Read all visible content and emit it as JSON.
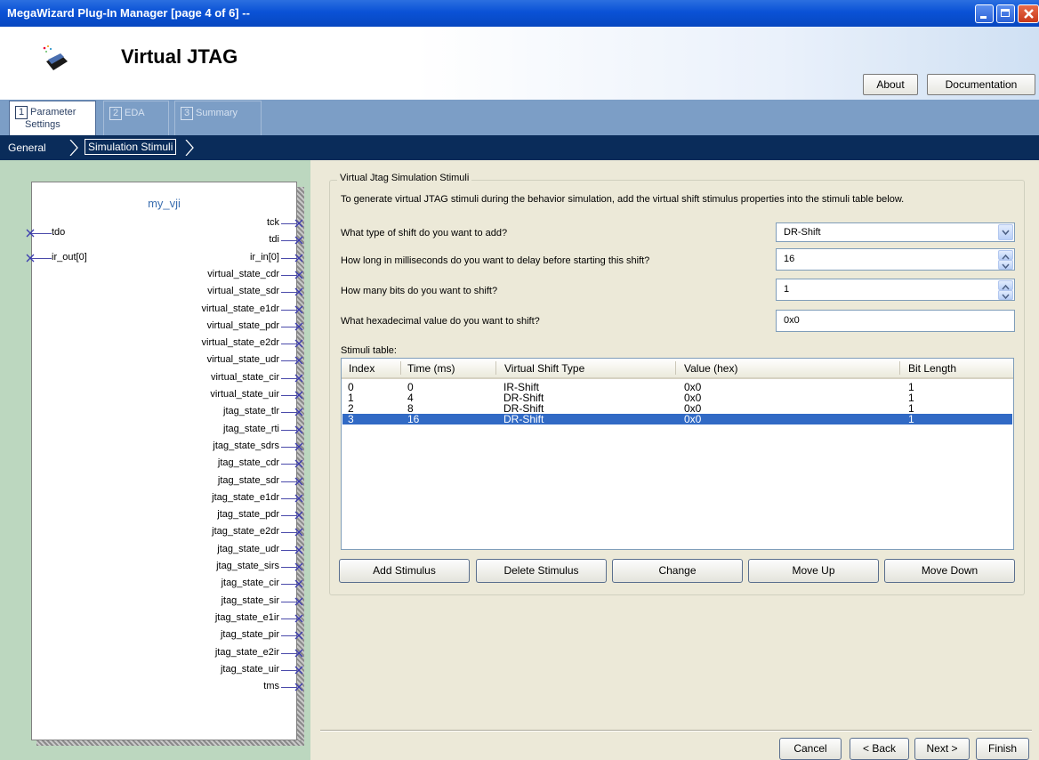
{
  "window": {
    "title": "MegaWizard Plug-In Manager [page 4 of 6] --"
  },
  "header": {
    "title": "Virtual JTAG",
    "about_label": "About",
    "documentation_label": "Documentation"
  },
  "tabs": [
    {
      "num": "1",
      "label_line1": "Parameter",
      "label_line2": "Settings"
    },
    {
      "num": "2",
      "label": "EDA"
    },
    {
      "num": "3",
      "label": "Summary"
    }
  ],
  "breadcrumb": {
    "general": "General",
    "simulation_stimuli": "Simulation Stimuli"
  },
  "symbol": {
    "name": "my_vji",
    "inputs": [
      "tdo",
      "ir_out[0]"
    ],
    "outputs": [
      "tck",
      "tdi",
      "ir_in[0]",
      "virtual_state_cdr",
      "virtual_state_sdr",
      "virtual_state_e1dr",
      "virtual_state_pdr",
      "virtual_state_e2dr",
      "virtual_state_udr",
      "virtual_state_cir",
      "virtual_state_uir",
      "jtag_state_tlr",
      "jtag_state_rti",
      "jtag_state_sdrs",
      "jtag_state_cdr",
      "jtag_state_sdr",
      "jtag_state_e1dr",
      "jtag_state_pdr",
      "jtag_state_e2dr",
      "jtag_state_udr",
      "jtag_state_sirs",
      "jtag_state_cir",
      "jtag_state_sir",
      "jtag_state_e1ir",
      "jtag_state_pir",
      "jtag_state_e2ir",
      "jtag_state_uir",
      "tms"
    ]
  },
  "stimuli_group": {
    "legend": "Virtual Jtag Simulation Stimuli",
    "intro": "To generate virtual JTAG stimuli during the behavior simulation, add the virtual shift stimulus properties into the stimuli table below.",
    "q_shift_type": "What type of shift do you want to add?",
    "shift_type_value": "DR-Shift",
    "q_delay": "How long in milliseconds do you want to delay before starting this shift?",
    "delay_value": "16",
    "q_bits": "How many bits do you want to shift?",
    "bits_value": "1",
    "q_hex": "What hexadecimal value do you want to shift?",
    "hex_value": "0x0",
    "table_label": "Stimuli table:",
    "columns": [
      "Index",
      "Time (ms)",
      "Virtual Shift Type",
      "Value (hex)",
      "Bit Length"
    ],
    "rows": [
      [
        "0",
        "0",
        "IR-Shift",
        "0x0",
        "1"
      ],
      [
        "1",
        "4",
        "DR-Shift",
        "0x0",
        "1"
      ],
      [
        "2",
        "8",
        "DR-Shift",
        "0x0",
        "1"
      ],
      [
        "3",
        "16",
        "DR-Shift",
        "0x0",
        "1"
      ]
    ],
    "selected_row": 3,
    "buttons": {
      "add": "Add Stimulus",
      "delete": "Delete Stimulus",
      "change": "Change",
      "up": "Move Up",
      "down": "Move Down"
    }
  },
  "nav": {
    "cancel": "Cancel",
    "back": "< Back",
    "next": "Next >",
    "finish": "Finish"
  },
  "colors": {
    "titlebar": "#0a52d6",
    "selection": "#316ac5",
    "diagram_bg": "#bcd7bf",
    "crumbbar": "#0a2c5a"
  }
}
